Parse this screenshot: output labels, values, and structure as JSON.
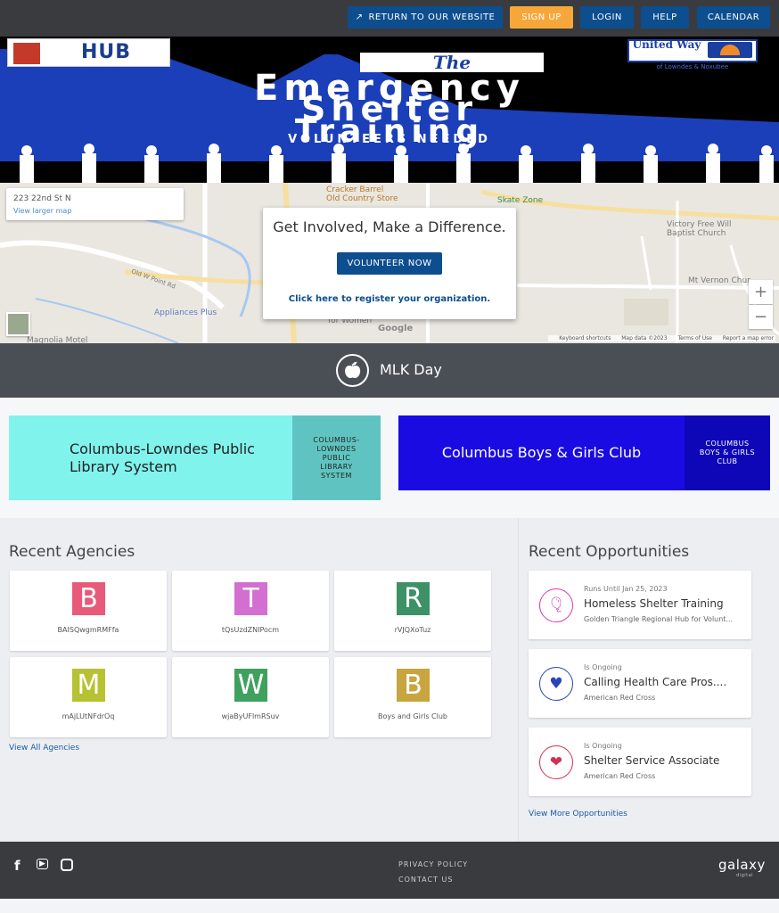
{
  "topbar": {
    "return_label": "RETURN TO OUR WEBSITE",
    "signup_label": "SIGN UP",
    "login_label": "LOGIN",
    "help_label": "HELP",
    "calendar_label": "CALENDAR"
  },
  "banner": {
    "hub_logo_text": "HUB",
    "the_text": "The",
    "title_line1": "Emergency",
    "title_line2": "Shelter",
    "title_line3": "Training",
    "title_line4": "VOLUNTEERS NEEDED",
    "uw_logo_text": "United Way",
    "uw_sub": "of Lowndes & Noxubee"
  },
  "map": {
    "address": "223 22nd St N",
    "view_larger": "View larger map",
    "labels": {
      "cracker_barrel": "Cracker Barrel",
      "old_country": "Old Country Store",
      "skate_zone": "Skate Zone",
      "victory": "Victory Free Will",
      "baptist": "Baptist Church",
      "mt_vernon": "Mt Vernon Chur",
      "appliances": "Appliances Plus",
      "for_women": "for Women",
      "magnolia": "Magnolia Motel",
      "old_west": "Old W Point Rd"
    },
    "google": "Google",
    "footer_shortcuts": "Keyboard shortcuts",
    "footer_data": "Map data ©2023",
    "footer_terms": "Terms of Use",
    "footer_report": "Report a map error"
  },
  "cta": {
    "heading": "Get Involved, Make a Difference.",
    "button": "VOLUNTEER NOW",
    "register": "Click here to register your organization."
  },
  "mlk": {
    "label": "MLK Day"
  },
  "featured": [
    {
      "name": "Columbus-Lowndes Public Library System",
      "side": "COLUMBUS-LOWNDES PUBLIC LIBRARY SYSTEM",
      "color": "#80f3ed"
    },
    {
      "name": "Columbus Boys & Girls Club",
      "side": "COLUMBUS BOYS & GIRLS CLUB",
      "color": "#1a0be3"
    }
  ],
  "agencies": {
    "heading": "Recent Agencies",
    "items": [
      {
        "letter": "B",
        "name": "BAISQwgmRMFfa",
        "color": "#e85a7a"
      },
      {
        "letter": "T",
        "name": "tQsUzdZNIPocm",
        "color": "#d36fd0"
      },
      {
        "letter": "R",
        "name": "rVJQXoTuz",
        "color": "#3d9166"
      },
      {
        "letter": "M",
        "name": "mAjLUtNFdrOq",
        "color": "#b7c232"
      },
      {
        "letter": "W",
        "name": "wjaByUFlmRSuv",
        "color": "#3fa15e"
      },
      {
        "letter": "B",
        "name": "Boys and Girls Club",
        "color": "#c8a53e"
      }
    ],
    "view_all": "View All Agencies"
  },
  "opportunities": {
    "heading": "Recent Opportunities",
    "items": [
      {
        "status": "Runs Until Jan 25, 2023",
        "title": "Homeless Shelter Training",
        "agency": "Golden Triangle Regional Hub for Volunt...",
        "icon": "balloon-icon",
        "color": "#d63aa8"
      },
      {
        "status": "Is Ongoing",
        "title": "Calling Health Care Pros....",
        "agency": "American Red Cross",
        "icon": "heartbeat-icon",
        "color": "#2a44b8"
      },
      {
        "status": "Is Ongoing",
        "title": "Shelter Service Associate",
        "agency": "American Red Cross",
        "icon": "heart-hands-icon",
        "color": "#d0334f"
      }
    ],
    "view_more": "View More Opportunities"
  },
  "footer": {
    "privacy": "PRIVACY POLICY",
    "contact": "CONTACT US",
    "brand": "galaxy",
    "brand_sub": "digital"
  }
}
